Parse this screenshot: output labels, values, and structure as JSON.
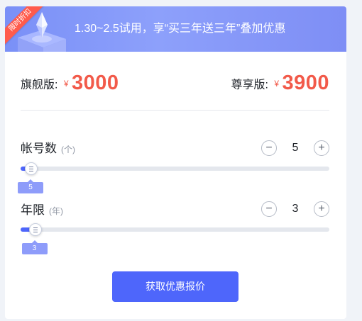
{
  "banner": {
    "ribbon_text": "限时折扣",
    "text": "1.30~2.5试用，享“买三年送三年”叠加优惠"
  },
  "prices": [
    {
      "label": "旗舰版:",
      "currency": "¥",
      "amount": "3000"
    },
    {
      "label": "尊享版:",
      "currency": "¥",
      "amount": "3900"
    }
  ],
  "accounts": {
    "label": "帐号数",
    "unit": "(个)",
    "value": "5",
    "minus": "−",
    "plus": "+",
    "tooltip": "5",
    "slider_fraction": 0.01
  },
  "years": {
    "label": "年限",
    "unit": "(年)",
    "value": "3",
    "minus": "−",
    "plus": "+",
    "tooltip": "3",
    "slider_fraction": 0.045
  },
  "cta_label": "获取优惠报价",
  "colors": {
    "accent": "#4e66fb",
    "price": "#f25a4a",
    "ribbon": "#ff5b4c"
  }
}
